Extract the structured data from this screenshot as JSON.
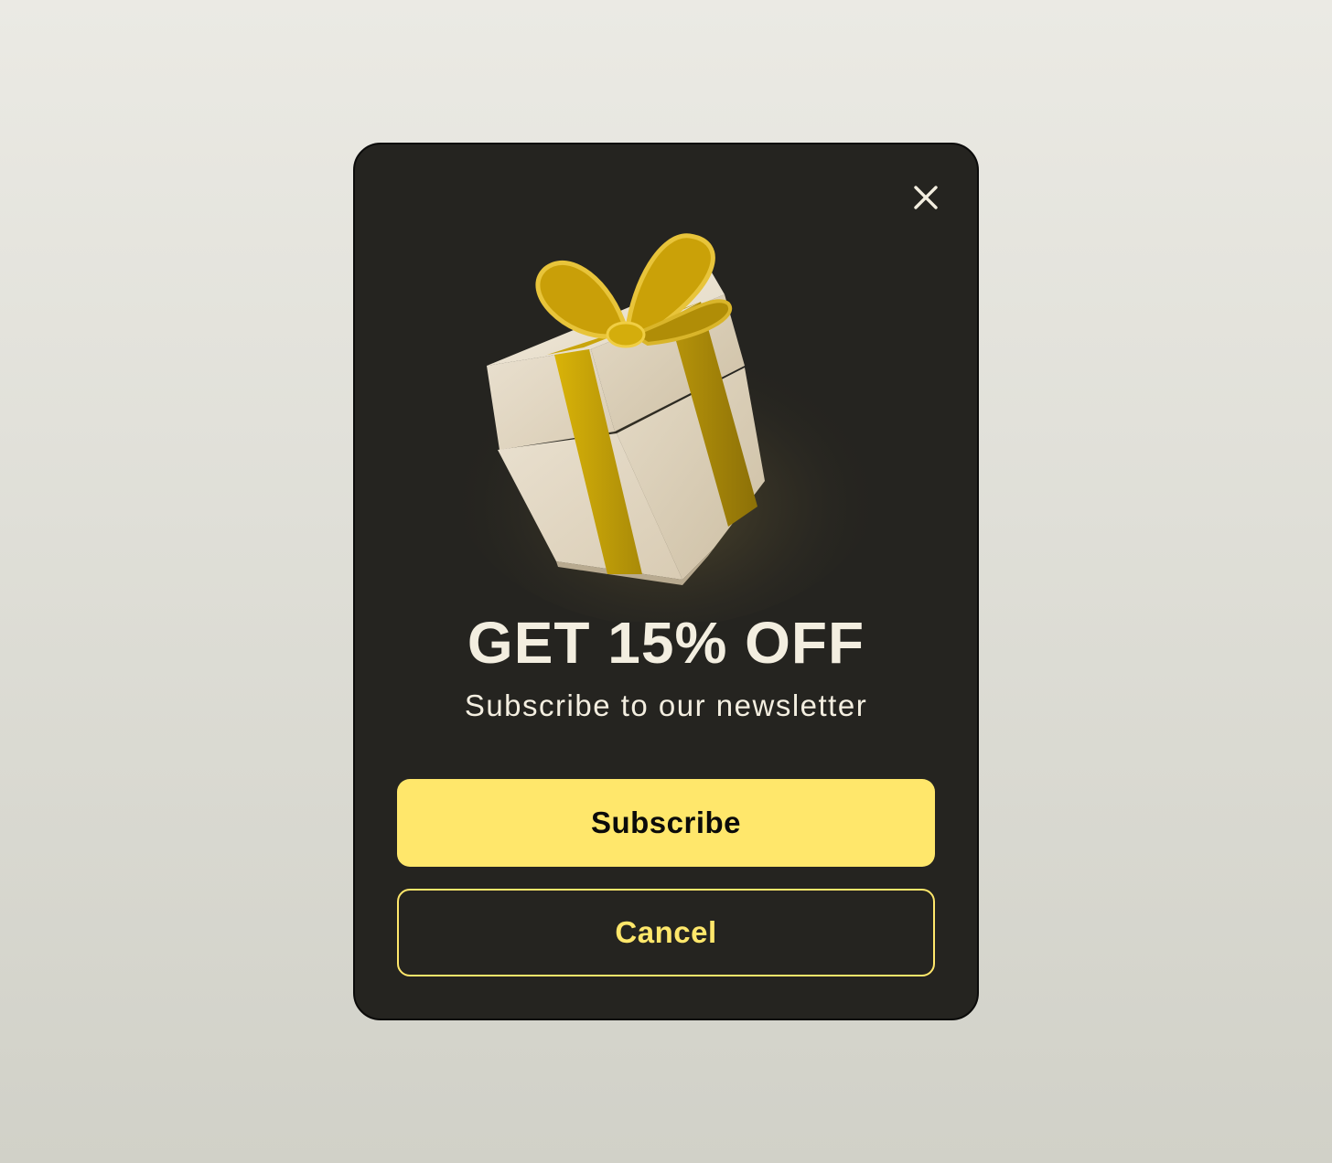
{
  "modal": {
    "headline": "GET 15% OFF",
    "subheadline": "Subscribe to our newsletter",
    "close_icon": "close-icon",
    "illustration": "gift-box-icon",
    "subscribe_label": "Subscribe",
    "cancel_label": "Cancel"
  },
  "colors": {
    "page_background_top": "#ebeae4",
    "page_background_bottom": "#d1d1c8",
    "modal_background": "#252420",
    "text_primary": "#f3eee0",
    "accent_yellow": "#ffe76b",
    "ribbon_gold": "#c8a20a",
    "box_cream": "#e6dccb"
  }
}
